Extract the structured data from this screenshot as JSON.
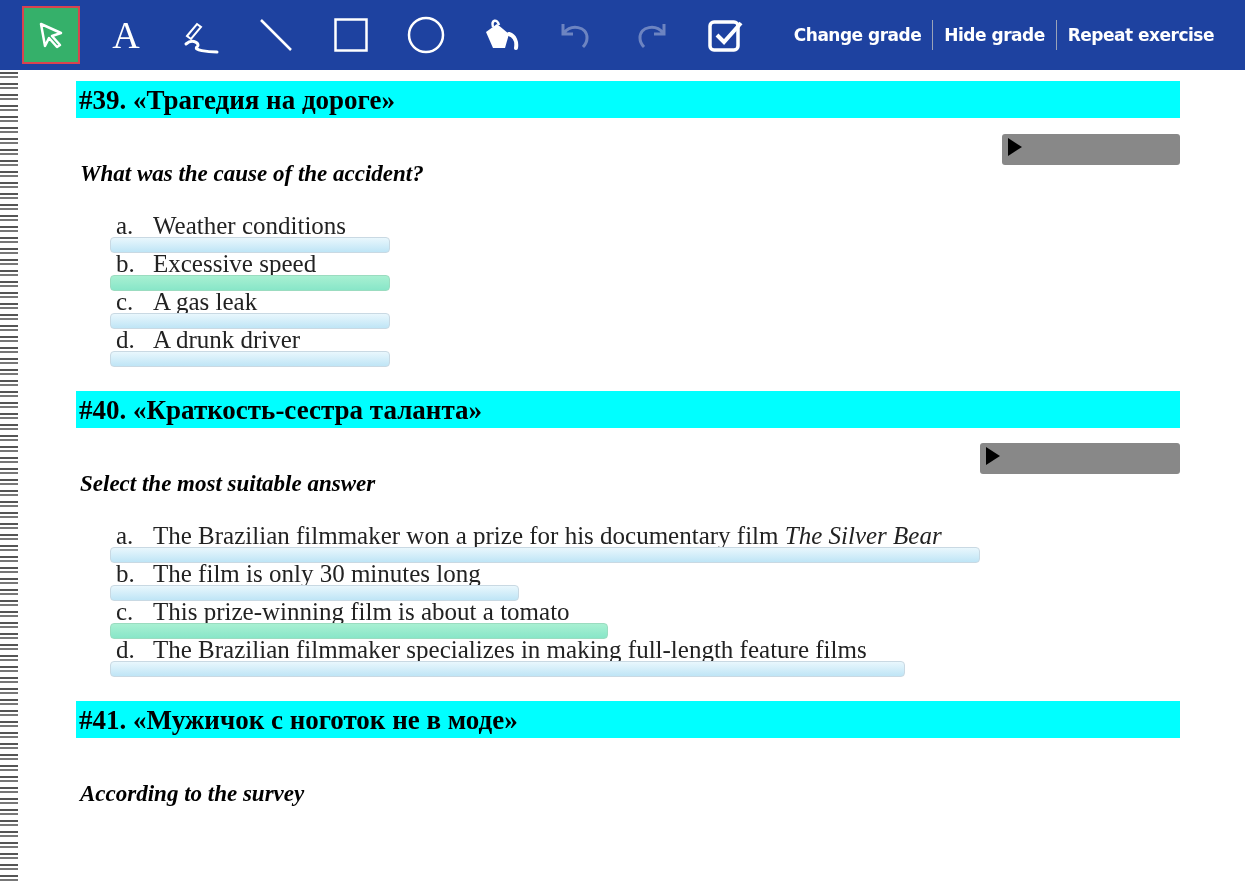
{
  "toolbar": {
    "tools": [
      {
        "kind": "pointer",
        "selected": true,
        "disabled": false
      },
      {
        "kind": "text",
        "glyph": "A",
        "selected": false,
        "disabled": false
      },
      {
        "kind": "pen",
        "selected": false,
        "disabled": false
      },
      {
        "kind": "line",
        "selected": false,
        "disabled": false
      },
      {
        "kind": "rectangle",
        "selected": false,
        "disabled": false
      },
      {
        "kind": "circle",
        "selected": false,
        "disabled": false
      },
      {
        "kind": "fill",
        "selected": false,
        "disabled": false
      },
      {
        "kind": "undo",
        "selected": false,
        "disabled": true
      },
      {
        "kind": "redo",
        "selected": false,
        "disabled": true
      },
      {
        "kind": "check",
        "selected": false,
        "disabled": false
      }
    ],
    "links": [
      "Change grade",
      "Hide grade",
      "Repeat exercise"
    ]
  },
  "exercises": [
    {
      "title": "#39. «Трагедия на дороге»",
      "question": "What was the cause of the accident?",
      "audio": true,
      "options": [
        {
          "letter": "a.",
          "text": "Weather conditions",
          "selected": false
        },
        {
          "letter": "b.",
          "text": "Excessive speed",
          "selected": true
        },
        {
          "letter": "c.",
          "text": "A gas leak",
          "selected": false
        },
        {
          "letter": "d.",
          "text": "A drunk driver",
          "selected": false
        }
      ]
    },
    {
      "title": "#40. «Краткость-сестра таланта»",
      "question": "Select the most suitable answer",
      "audio": true,
      "options": [
        {
          "letter": "a.",
          "text": "The Brazilian filmmaker won a prize for his documentary film *The Silver Bear*",
          "selected": false
        },
        {
          "letter": "b.",
          "text": "The film is only 30 minutes long",
          "selected": false
        },
        {
          "letter": "c.",
          "text": "This prize-winning film is about a tomato",
          "selected": true
        },
        {
          "letter": "d.",
          "text": "The Brazilian filmmaker specializes in making full-length feature films",
          "selected": false
        }
      ]
    },
    {
      "title": "#41. «Мужичок с ноготок не в моде»",
      "question": "According to the survey"
    }
  ]
}
